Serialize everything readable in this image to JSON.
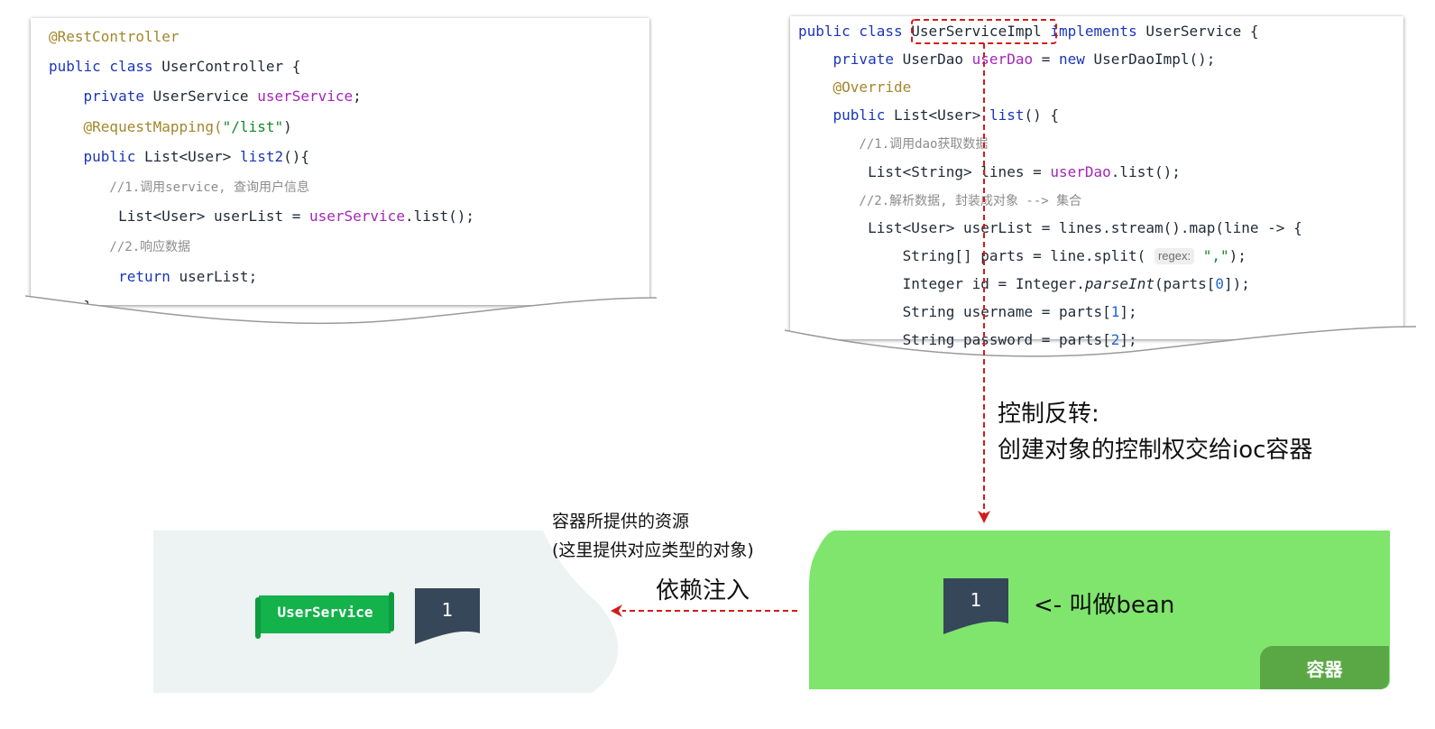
{
  "colors": {
    "accent_red": "#d31b1b",
    "container_green": "#7fe56d",
    "container_tab": "#5aa845",
    "bean_dark": "#37475a",
    "userservice_green": "#13b24b",
    "panel_gray": "#edf2f2"
  },
  "controller_code": {
    "lines": [
      {
        "parts": [
          {
            "t": "@RestController",
            "c": "ann"
          }
        ]
      },
      {
        "parts": [
          {
            "t": "public class ",
            "c": "kw"
          },
          {
            "t": "UserController {",
            "c": ""
          }
        ]
      },
      {
        "parts": [
          {
            "t": "    private ",
            "c": "kw"
          },
          {
            "t": "UserService ",
            "c": ""
          },
          {
            "t": "userService",
            "c": "fld"
          },
          {
            "t": ";",
            "c": ""
          }
        ]
      },
      {
        "parts": [
          {
            "t": "    @RequestMapping(",
            "c": "ann"
          },
          {
            "t": "\"/list\"",
            "c": "str"
          },
          {
            "t": ")",
            "c": ""
          }
        ]
      },
      {
        "parts": [
          {
            "t": "    public ",
            "c": "kw"
          },
          {
            "t": "List<User> ",
            "c": ""
          },
          {
            "t": "list2",
            "c": "kw"
          },
          {
            "t": "(){",
            "c": ""
          }
        ]
      },
      {
        "parts": [
          {
            "t": "        //1.调用service, 查询用户信息",
            "c": "cm"
          }
        ]
      },
      {
        "parts": [
          {
            "t": "        List<User> userList = ",
            "c": ""
          },
          {
            "t": "userService",
            "c": "fld"
          },
          {
            "t": ".list();",
            "c": ""
          }
        ]
      },
      {
        "parts": [
          {
            "t": "        //2.响应数据",
            "c": "cm"
          }
        ]
      },
      {
        "parts": [
          {
            "t": "        return ",
            "c": "kw"
          },
          {
            "t": "userList;",
            "c": ""
          }
        ]
      },
      {
        "parts": [
          {
            "t": "    }",
            "c": ""
          }
        ]
      }
    ]
  },
  "impl_code": {
    "lines": [
      {
        "parts": [
          {
            "t": "public class ",
            "c": "kw"
          },
          {
            "t": "UserServiceImpl",
            "c": "hl"
          },
          {
            "t": " implements ",
            "c": "kw"
          },
          {
            "t": "UserService {",
            "c": ""
          }
        ]
      },
      {
        "parts": [
          {
            "t": "    private ",
            "c": "kw"
          },
          {
            "t": "UserDao ",
            "c": ""
          },
          {
            "t": "userDao",
            "c": "fld"
          },
          {
            "t": " = ",
            "c": ""
          },
          {
            "t": "new ",
            "c": "kw"
          },
          {
            "t": "UserDaoImpl();",
            "c": ""
          }
        ]
      },
      {
        "parts": [
          {
            "t": "    @Override",
            "c": "ann"
          }
        ]
      },
      {
        "parts": [
          {
            "t": "    public ",
            "c": "kw"
          },
          {
            "t": "List<User> ",
            "c": ""
          },
          {
            "t": "list",
            "c": "kw"
          },
          {
            "t": "() {",
            "c": ""
          }
        ]
      },
      {
        "parts": [
          {
            "t": "        //1.调用dao获取数据",
            "c": "cm"
          }
        ]
      },
      {
        "parts": [
          {
            "t": "        List<String> lines = ",
            "c": ""
          },
          {
            "t": "userDao",
            "c": "fld"
          },
          {
            "t": ".list();",
            "c": ""
          }
        ]
      },
      {
        "parts": [
          {
            "t": "        //2.解析数据, 封装成对象 --> 集合",
            "c": "cm"
          }
        ]
      },
      {
        "parts": [
          {
            "t": "        List<User> userList = lines.stream().map(line -> {",
            "c": ""
          }
        ]
      },
      {
        "parts": [
          {
            "t": "            String[] parts = line.split( ",
            "c": ""
          },
          {
            "t": "regex:",
            "c": "hint"
          },
          {
            "t": " ",
            "c": ""
          },
          {
            "t": "\",\"",
            "c": "str"
          },
          {
            "t": ");",
            "c": ""
          }
        ]
      },
      {
        "parts": [
          {
            "t": "            Integer id = Integer.",
            "c": ""
          },
          {
            "t": "parseInt",
            "c": "it"
          },
          {
            "t": "(parts[",
            "c": ""
          },
          {
            "t": "0",
            "c": "num"
          },
          {
            "t": "]);",
            "c": ""
          }
        ]
      },
      {
        "parts": [
          {
            "t": "            String username = parts[",
            "c": ""
          },
          {
            "t": "1",
            "c": "num"
          },
          {
            "t": "];",
            "c": ""
          }
        ]
      },
      {
        "parts": [
          {
            "t": "            String password = parts[",
            "c": ""
          },
          {
            "t": "2",
            "c": "num"
          },
          {
            "t": "];",
            "c": ""
          }
        ]
      }
    ]
  },
  "labels": {
    "ioc_title": "控制反转:",
    "ioc_desc": "创建对象的控制权交给ioc容器",
    "provided_line1": "容器所提供的资源",
    "provided_line2": "(这里提供对应类型的对象)",
    "di": "依赖注入",
    "bean_note": "<- 叫做bean",
    "container": "容器",
    "userservice_chip": "UserService",
    "bean_number": "1"
  }
}
